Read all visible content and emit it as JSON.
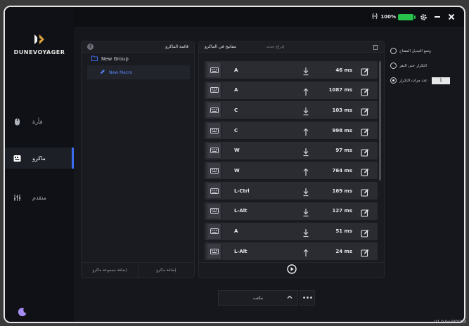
{
  "topbar": {
    "battery_text": "100%",
    "battery_color": "#27c24a"
  },
  "brand": {
    "name": "DUNEVOYAGER"
  },
  "nav": {
    "items": [
      {
        "label": "فأرة",
        "icon": "mouse-icon"
      },
      {
        "label": "ماكرو",
        "icon": "keyboard-icon",
        "active": true
      },
      {
        "label": "متقدم",
        "icon": "sliders-icon"
      }
    ]
  },
  "macro_list": {
    "title": "قائمة الماكرو",
    "group_name": "New Group",
    "macro_name": "New Macro",
    "add_group_label": "إضافة مجموعة ماكرو",
    "add_macro_label": "إضافة ماكرو"
  },
  "macro_keys": {
    "title": "مفاتيح في الماكرو",
    "insert_label": "إدراج حدث",
    "rows": [
      {
        "key": "A",
        "direction": "down",
        "delay": "46 ms"
      },
      {
        "key": "A",
        "direction": "up",
        "delay": "1087 ms"
      },
      {
        "key": "C",
        "direction": "down",
        "delay": "103 ms"
      },
      {
        "key": "C",
        "direction": "up",
        "delay": "998 ms"
      },
      {
        "key": "W",
        "direction": "down",
        "delay": "97 ms"
      },
      {
        "key": "W",
        "direction": "up",
        "delay": "764 ms"
      },
      {
        "key": "L-Ctrl",
        "direction": "down",
        "delay": "169 ms"
      },
      {
        "key": "L-Alt",
        "direction": "down",
        "delay": "127 ms"
      },
      {
        "key": "A",
        "direction": "down",
        "delay": "51 ms"
      },
      {
        "key": "L-Alt",
        "direction": "up",
        "delay": "24 ms"
      }
    ]
  },
  "options": {
    "items": [
      {
        "label": "وضع التبديل المفتاح",
        "selected": false
      },
      {
        "label": "التكرار حتى النقر",
        "selected": false
      },
      {
        "label": "عدد مرات التكرار",
        "selected": true
      }
    ],
    "repeat_count": "1"
  },
  "bottom": {
    "select_value": "مكتب"
  },
  "version": "V1.0 build0003",
  "accent_color": "#3b6cf0"
}
